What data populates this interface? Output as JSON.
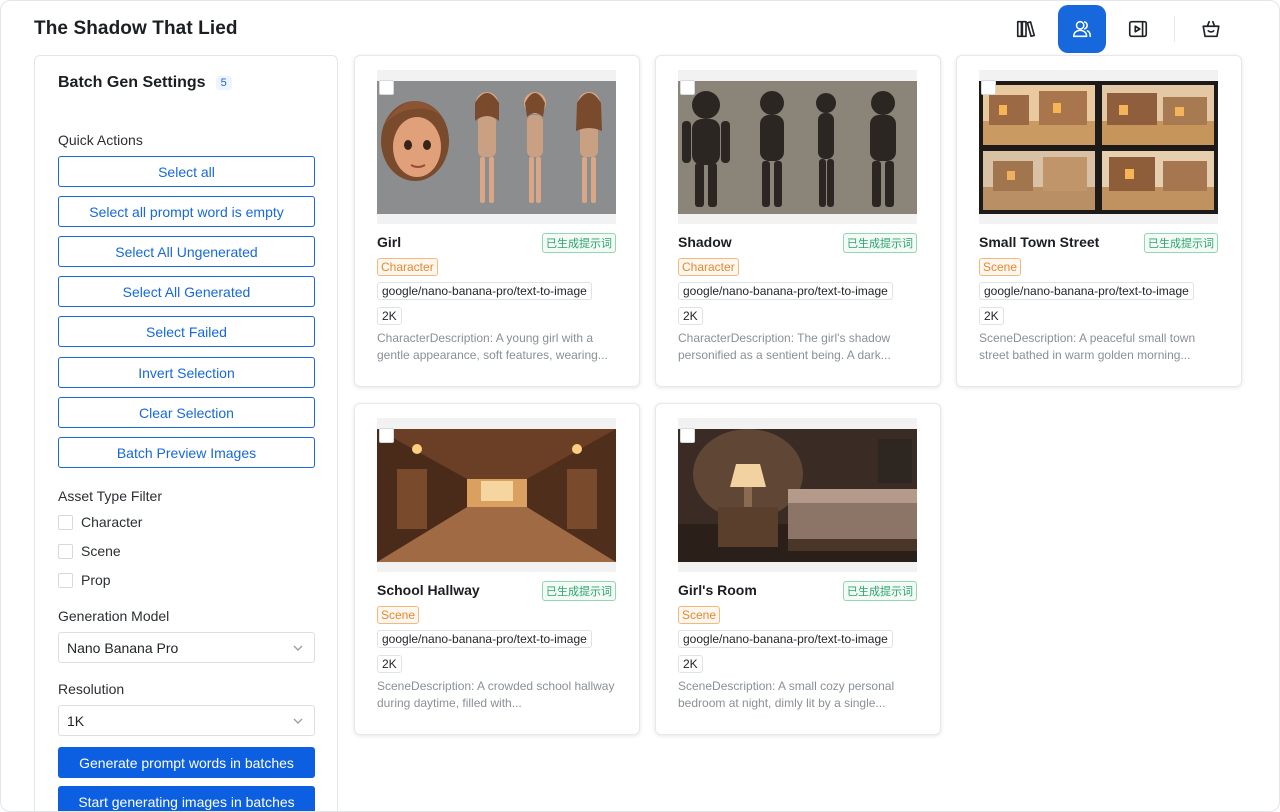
{
  "header": {
    "title": "The Shadow That Lied",
    "nav": [
      {
        "icon": "library-icon",
        "active": false
      },
      {
        "icon": "users-icon",
        "active": true
      },
      {
        "icon": "play-icon",
        "active": false
      },
      {
        "icon": "shopping-bag-icon",
        "active": false
      }
    ]
  },
  "sidebar": {
    "title": "Batch Gen Settings",
    "count": "5",
    "quick_actions_label": "Quick Actions",
    "quick_actions": [
      "Select all",
      "Select all prompt word is empty",
      "Select All Ungenerated",
      "Select All Generated",
      "Select Failed",
      "Invert Selection",
      "Clear Selection",
      "Batch Preview Images"
    ],
    "asset_filter_label": "Asset Type Filter",
    "asset_filters": [
      "Character",
      "Scene",
      "Prop"
    ],
    "model_label": "Generation Model",
    "model_value": "Nano Banana Pro",
    "resolution_label": "Resolution",
    "resolution_value": "1K",
    "generate_prompts_label": "Generate prompt words in batches",
    "generate_images_label": "Start generating images in batches"
  },
  "cards": [
    {
      "name": "Girl",
      "status": "已生成提示词",
      "type": "Character",
      "model": "google/nano-banana-pro/text-to-image",
      "resolution": "2K",
      "description": "CharacterDescription: A young girl with a gentle appearance, soft features, wearing...",
      "thumb_icon": "girl-character-sheet-image"
    },
    {
      "name": "Shadow",
      "status": "已生成提示词",
      "type": "Character",
      "model": "google/nano-banana-pro/text-to-image",
      "resolution": "2K",
      "description": "CharacterDescription: The girl's shadow personified as a sentient being. A dark...",
      "thumb_icon": "shadow-character-sheet-image"
    },
    {
      "name": "Small Town Street",
      "status": "已生成提示词",
      "type": "Scene",
      "model": "google/nano-banana-pro/text-to-image",
      "resolution": "2K",
      "description": "SceneDescription: A peaceful small town street bathed in warm golden morning...",
      "thumb_icon": "town-street-image"
    },
    {
      "name": "School Hallway",
      "status": "已生成提示词",
      "type": "Scene",
      "model": "google/nano-banana-pro/text-to-image",
      "resolution": "2K",
      "description": "SceneDescription: A crowded school hallway during daytime, filled with...",
      "thumb_icon": "school-hallway-image"
    },
    {
      "name": "Girl's Room",
      "status": "已生成提示词",
      "type": "Scene",
      "model": "google/nano-banana-pro/text-to-image",
      "resolution": "2K",
      "description": "SceneDescription: A small cozy personal bedroom at night, dimly lit by a single...",
      "thumb_icon": "bedroom-image"
    }
  ],
  "colors": {
    "accent": "#1668dc",
    "primary_button": "#0b5fe0",
    "status_green": "#2ea36b",
    "tag_orange": "#e08a2f"
  }
}
